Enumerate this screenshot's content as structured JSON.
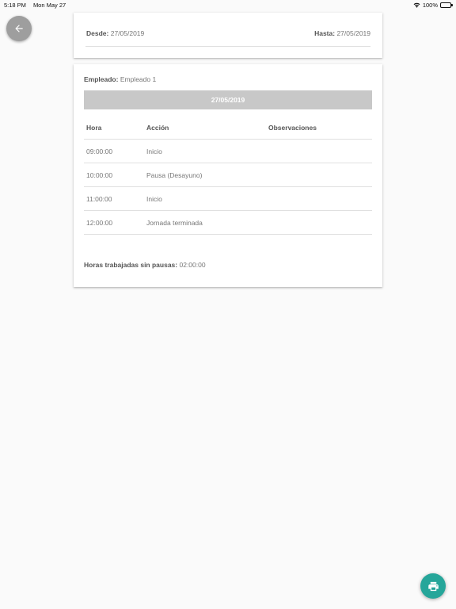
{
  "status_bar": {
    "time": "5:18 PM",
    "date": "Mon May 27",
    "battery": "100%",
    "icons": [
      "wifi-icon",
      "battery-icon"
    ]
  },
  "navigation": {
    "back_icon": "arrow-left-icon"
  },
  "date_range": {
    "from_label": "Desde:",
    "from_value": "27/05/2019",
    "to_label": "Hasta:",
    "to_value": "27/05/2019"
  },
  "report": {
    "employee_label": "Empleado:",
    "employee_value": "Empleado 1",
    "day_header": "27/05/2019",
    "columns": [
      "Hora",
      "Acción",
      "Observaciones"
    ],
    "rows": [
      {
        "hora": "09:00:00",
        "accion": "Inicio",
        "observaciones": ""
      },
      {
        "hora": "10:00:00",
        "accion": "Pausa (Desayuno)",
        "observaciones": ""
      },
      {
        "hora": "11:00:00",
        "accion": "Inicio",
        "observaciones": ""
      },
      {
        "hora": "12:00:00",
        "accion": "Jornada terminada",
        "observaciones": ""
      }
    ],
    "summary_label": "Horas trabajadas sin pausas:",
    "summary_value": "02:00:00"
  },
  "actions": {
    "print_icon": "printer-icon"
  },
  "colors": {
    "fab_print": "#26a69a",
    "fab_back": "#9e9e9e",
    "banner": "#c8c8c8",
    "background": "#fafafa"
  }
}
